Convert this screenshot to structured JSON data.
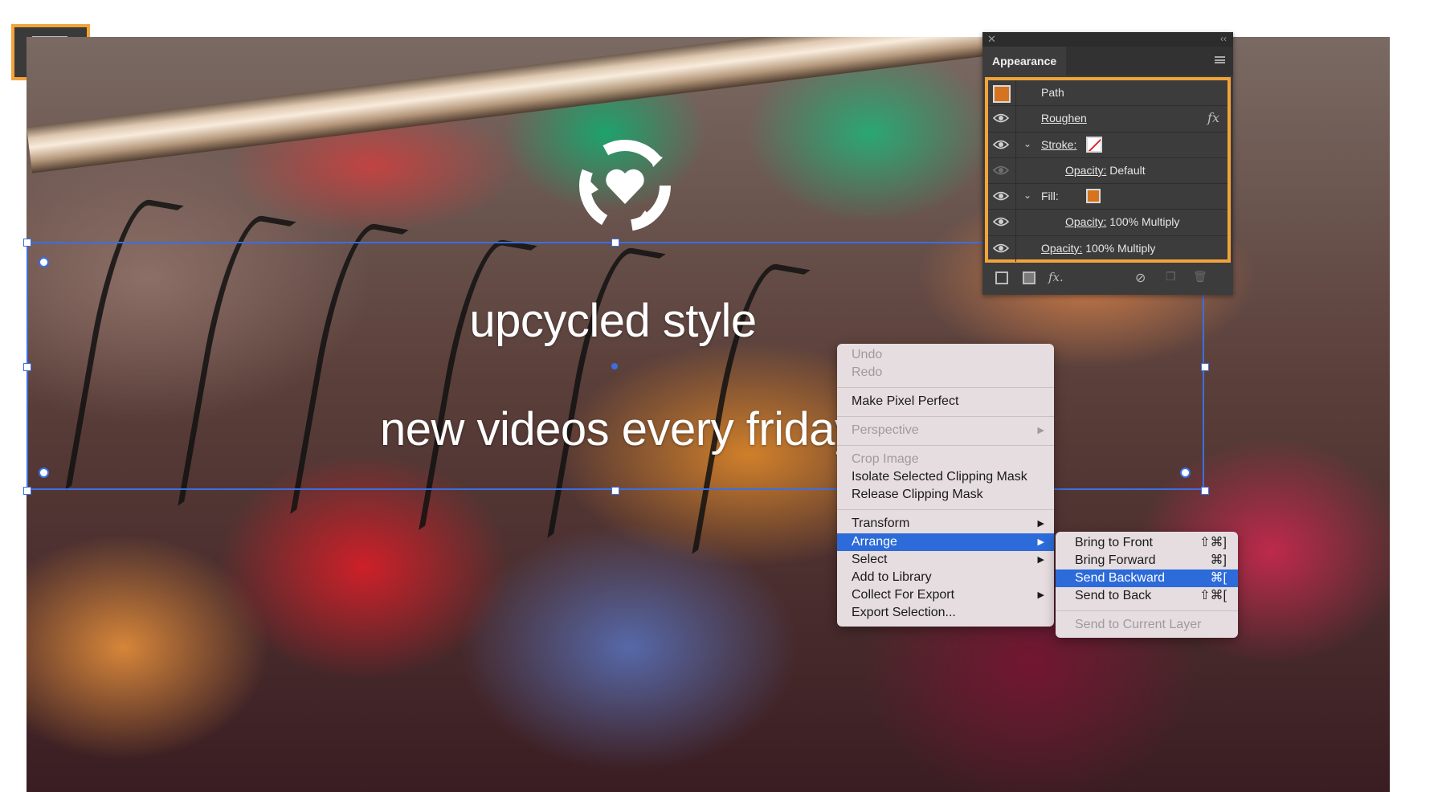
{
  "canvas": {
    "headline": "upcycled style",
    "subline": "new videos every friday"
  },
  "appearance_panel": {
    "title": "Appearance",
    "rows": [
      {
        "label": "Path"
      },
      {
        "label": "Roughen"
      },
      {
        "label": "Stroke:"
      },
      {
        "label_link": "Opacity:",
        "label_value": " Default"
      },
      {
        "label": "Fill:"
      },
      {
        "label_link": "Opacity:",
        "label_value": " 100% Multiply"
      },
      {
        "label_link": "Opacity:",
        "label_value": " 100% Multiply"
      }
    ],
    "fx_label": "fx",
    "fill_color": "#d6731f",
    "stroke_color": "none"
  },
  "context_menu": {
    "items": [
      {
        "label": "Undo",
        "disabled": true
      },
      {
        "label": "Redo",
        "disabled": true
      },
      {
        "label": "Make Pixel Perfect"
      },
      {
        "label": "Perspective",
        "disabled": true
      },
      {
        "label": "Crop Image",
        "disabled": true
      },
      {
        "label": "Isolate Selected Clipping Mask"
      },
      {
        "label": "Release Clipping Mask"
      },
      {
        "label": "Transform"
      },
      {
        "label": "Arrange",
        "highlighted": true
      },
      {
        "label": "Select"
      },
      {
        "label": "Add to Library"
      },
      {
        "label": "Collect For Export"
      },
      {
        "label": "Export Selection..."
      }
    ],
    "submenu_arrow": "▶"
  },
  "arrange_submenu": {
    "items": [
      {
        "label": "Bring to Front",
        "shortcut": "⇧⌘]"
      },
      {
        "label": "Bring Forward",
        "shortcut": "⌘]"
      },
      {
        "label": "Send Backward",
        "shortcut": "⌘[",
        "highlighted": true
      },
      {
        "label": "Send to Back",
        "shortcut": "⇧⌘["
      },
      {
        "label": "Send to Current Layer",
        "disabled": true
      }
    ]
  },
  "colors": {
    "accent_orange": "#f2a33a",
    "selection_blue": "#3b6fe0",
    "menu_highlight": "#2c6bd9"
  }
}
